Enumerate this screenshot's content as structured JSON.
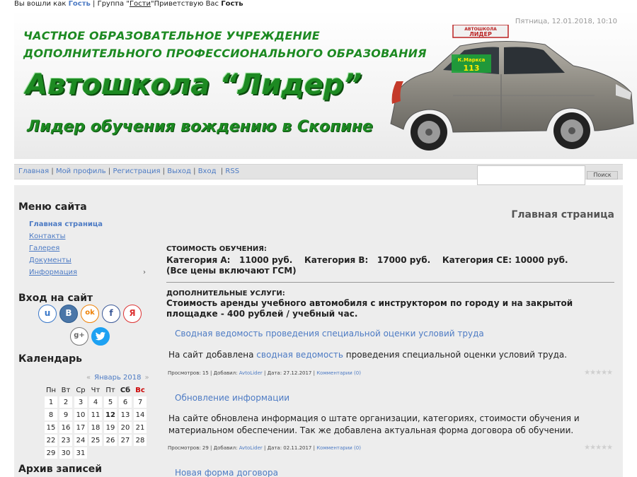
{
  "topbar": {
    "logged_as": "Вы вошли как",
    "user": "Гость",
    "group_sep": "| Группа \"",
    "group": "Гости",
    "greeting": "\"Приветствую Вас",
    "greet_user": "Гость"
  },
  "header": {
    "datetime": "Пятница, 12.01.2018, 10:10",
    "line1": "ЧАСТНОЕ ОБРАЗОВАТЕЛЬНОЕ УЧРЕЖДЕНИЕ",
    "line2": "ДОПОЛНИТЕЛЬНОГО ПРОФЕССИОНАЛЬНОГО ОБРАЗОВАНИЯ",
    "title": "Автошкола “Лидер”",
    "slogan": "Лидер обучения вождению в Скопине",
    "car_sign": "АВТОШКОЛА",
    "car_sign_big": "ЛИДЕР",
    "car_window": "К.Маркса",
    "car_number": "113"
  },
  "nav": {
    "items": [
      "Главная",
      "Мой профиль",
      "Регистрация",
      "Выход",
      "Вход",
      "RSS"
    ],
    "search_button": "Поиск",
    "search_placeholder": ""
  },
  "sidebar": {
    "menu_title": "Меню сайта",
    "menu": [
      "Главная страница",
      "Контакты",
      "Галерея",
      "Документы",
      "Информация"
    ],
    "login_title": "Вход на сайт",
    "social": [
      "u",
      "B",
      "ok",
      "f",
      "Я",
      "g+",
      "twitter"
    ],
    "calendar_title": "Календарь",
    "calendar_month": "Январь 2018",
    "calendar_prev": "«",
    "calendar_next": "»",
    "weekdays": [
      "Пн",
      "Вт",
      "Ср",
      "Чт",
      "Пт",
      "Сб",
      "Вс"
    ],
    "weeks": [
      [
        "1",
        "2",
        "3",
        "4",
        "5",
        "6",
        "7"
      ],
      [
        "8",
        "9",
        "10",
        "11",
        "12",
        "13",
        "14"
      ],
      [
        "15",
        "16",
        "17",
        "18",
        "19",
        "20",
        "21"
      ],
      [
        "22",
        "23",
        "24",
        "25",
        "26",
        "27",
        "28"
      ],
      [
        "29",
        "30",
        "31",
        "",
        "",
        "",
        ""
      ]
    ],
    "today": "12",
    "archive_title": "Архив записей"
  },
  "main": {
    "page_title": "Главная страница",
    "price_label": "СТОИМОСТЬ ОБУЧЕНИЯ:",
    "price_row": "Категория А:   11000 руб.    Категория В:   17000 руб.    Категория СЕ: 10000 руб.",
    "price_note": "(Все цены включают ГСМ)",
    "extra_label": "ДОПОЛНИТЕЛЬНЫЕ УСЛУГИ:",
    "extra_text": "Стоимость аренды учебного автомобиля с инструктором по городу и на закрытой площадке - 400 рублей / учебный час."
  },
  "posts": [
    {
      "title": "Сводная ведомость проведения специальной оценки условий труда",
      "body_pre": "На сайт добавлена ",
      "body_link": "сводная ведомость",
      "body_post": " проведения специальной оценки условий труда.",
      "views": "Просмотров: 15",
      "added": "Добавил:",
      "author": "AvtoLider",
      "date": "Дата: 27.12.2017",
      "comments": "Комментарии (0)"
    },
    {
      "title": "Обновление информации",
      "body": "На сайте обновлена информация о штате организации, категориях, стоимости обучения и материальном обеспечении. Так же добавлена актуальная форма договора об обучении.",
      "views": "Просмотров: 29",
      "added": "Добавил:",
      "author": "AvtoLider",
      "date": "Дата: 02.11.2017",
      "comments": "Комментарии (0)"
    },
    {
      "title": "Новая форма договора"
    }
  ],
  "colors": {
    "accent_green": "#1d8a22",
    "link_blue": "#4d7bc4",
    "sunday_red": "#cc0000"
  }
}
